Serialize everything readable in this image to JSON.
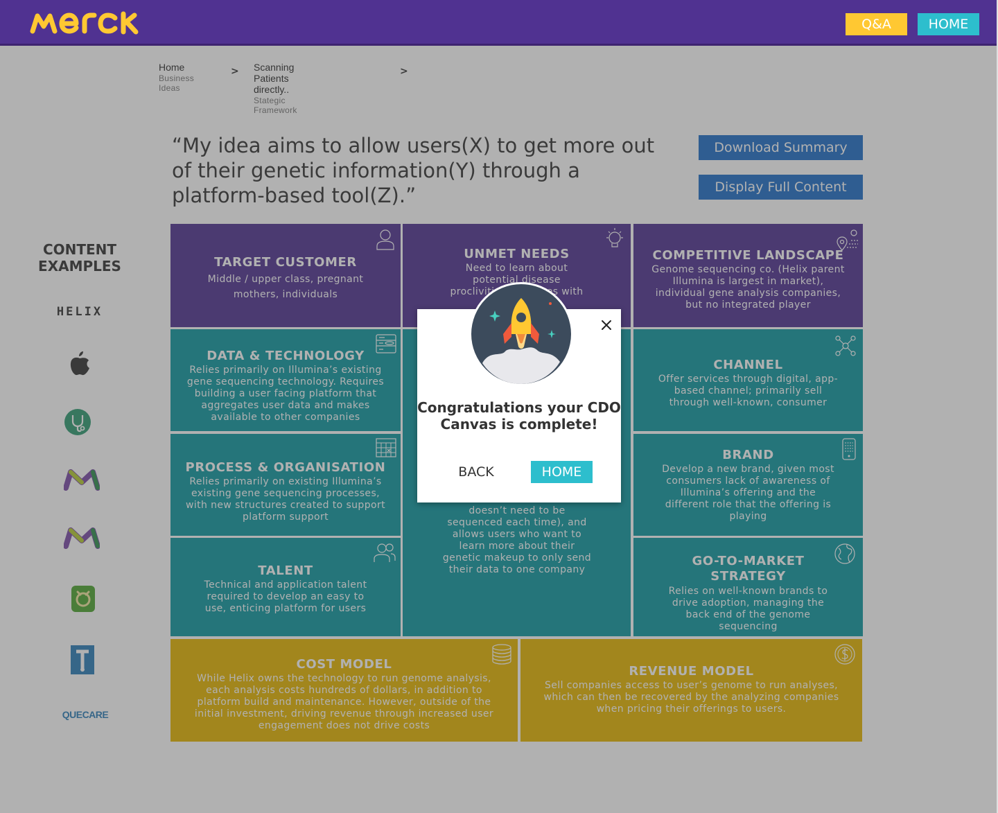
{
  "header": {
    "logo_text": "MERCK",
    "qa_label": "Q&A",
    "home_label": "HOME"
  },
  "breadcrumb": [
    {
      "title": "Home",
      "subtitle": "Business Ideas"
    },
    {
      "title": "Scanning Patients directly..",
      "subtitle": "Stategic Framework"
    }
  ],
  "quote": "“My idea aims to allow users(X) to get more out of their genetic information(Y) through a platform-based tool(Z).”",
  "actions": {
    "download_summary": "Download Summary",
    "display_full_content": "Display Full Content"
  },
  "content_examples": {
    "title": "CONTENT EXAMPLES",
    "helix_label": "HELIX",
    "quecare_label": "QUECARE",
    "logos": [
      "helix",
      "apple",
      "stethoscope-app",
      "merck-m",
      "merck-m",
      "green-app",
      "blue-t-app",
      "quecare"
    ]
  },
  "canvas": {
    "target_customer": {
      "title": "TARGET CUSTOMER",
      "body": "Middle / upper class, pregnant mothers, individuals"
    },
    "unmet_needs": {
      "title": "UNMET NEEDS",
      "body": "Need to learn about potential disease proclivities, or issues with unborn"
    },
    "competitive_landscape": {
      "title": "COMPETITIVE LANDSCAPE",
      "body": "Genome sequencing co. (Helix parent Illumina is largest in market), individual gene analysis companies, but no integrated player"
    },
    "data_technology": {
      "title": "DATA & TECHNOLOGY",
      "body": "Relies primarily on Illumina’s existing gene sequencing technology. Requires building a user facing platform that aggregates user data and makes available to other companies"
    },
    "value_proposition": {
      "body": "doesn’t need to be sequenced each time), and allows users who want to learn more about their genetic makeup to only send their data to one company"
    },
    "channel": {
      "title": "CHANNEL",
      "body": "Offer services through digital, app-based channel; primarily sell through well-known, consumer"
    },
    "process_organisation": {
      "title": "PROCESS & ORGANISATION",
      "body": "Relies primarily on existing Illumina’s existing gene sequencing processes, with new structures created to support platform support"
    },
    "brand": {
      "title": "BRAND",
      "body": "Develop a new brand, given most consumers lack of awareness of Illumina’s offering and the different role that the offering is playing"
    },
    "talent": {
      "title": "TALENT",
      "body": "Technical and application talent required to develop an easy to use, enticing platform for users"
    },
    "go_to_market": {
      "title": "GO-TO-MARKET STRATEGY",
      "body": "Relies on well-known brands to drive adoption, managing the back end of the genome sequencing"
    },
    "cost_model": {
      "title": "COST MODEL",
      "body": "While Helix owns the technology to run genome analysis, each analysis costs hundreds of dollars, in addition to platform build and maintenance. However, outside of the initial investment, driving revenue through increased user engagement does not drive costs"
    },
    "revenue_model": {
      "title": "REVENUE MODEL",
      "body": "Sell companies access to user’s genome to run analyses, which can then be recovered by the analyzing companies when pricing their offerings to users."
    }
  },
  "modal": {
    "message": "Congratulations your CDO Canvas is complete!",
    "back_label": "BACK",
    "home_label": "HOME"
  },
  "colors": {
    "header_purple": "#503291",
    "canvas_purple": "#503291",
    "canvas_teal": "#0f98a0",
    "canvas_gold": "#e6b600",
    "qa_yellow": "#ffc832",
    "home_cyan": "#2dbecd",
    "action_blue": "#1f6fc8"
  }
}
